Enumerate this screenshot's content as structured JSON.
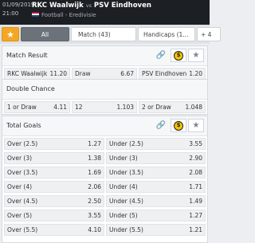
{
  "header": {
    "date": "01/09/2019",
    "time": "21:00",
    "home_team": "RKC Waalwijk",
    "vs": "vs",
    "away_team": "PSV Eindhoven",
    "league": "Football - Eredivisie"
  },
  "tabs": {
    "star": "★",
    "all": "All",
    "match": "Match (43)",
    "handicaps": "Handicaps (1...",
    "more": "+ 4"
  },
  "icons": {
    "link": "🔗",
    "coin": "$",
    "star": "★"
  },
  "markets": {
    "match_result": {
      "title": "Match Result",
      "outcomes": [
        {
          "label": "RKC Waalwijk",
          "odds": "11.20"
        },
        {
          "label": "Draw",
          "odds": "6.67"
        },
        {
          "label": "PSV Eindhoven",
          "odds": "1.20"
        }
      ]
    },
    "double_chance": {
      "title": "Double Chance",
      "outcomes": [
        {
          "label": "1 or Draw",
          "odds": "4.11"
        },
        {
          "label": "12",
          "odds": "1.103"
        },
        {
          "label": "2 or Draw",
          "odds": "1.048"
        }
      ]
    },
    "total_goals": {
      "title": "Total Goals",
      "rows": [
        {
          "over": "Over (2.5)",
          "over_odds": "1.27",
          "under": "Under (2.5)",
          "under_odds": "3.55"
        },
        {
          "over": "Over (3)",
          "over_odds": "1.38",
          "under": "Under (3)",
          "under_odds": "2.90"
        },
        {
          "over": "Over (3.5)",
          "over_odds": "1.69",
          "under": "Under (3.5)",
          "under_odds": "2.08"
        },
        {
          "over": "Over (4)",
          "over_odds": "2.06",
          "under": "Under (4)",
          "under_odds": "1.71"
        },
        {
          "over": "Over (4.5)",
          "over_odds": "2.50",
          "under": "Under (4.5)",
          "under_odds": "1.49"
        },
        {
          "over": "Over (5)",
          "over_odds": "3.55",
          "under": "Under (5)",
          "under_odds": "1.27"
        },
        {
          "over": "Over (5.5)",
          "over_odds": "4.10",
          "under": "Under (5.5)",
          "under_odds": "1.21"
        }
      ]
    }
  }
}
